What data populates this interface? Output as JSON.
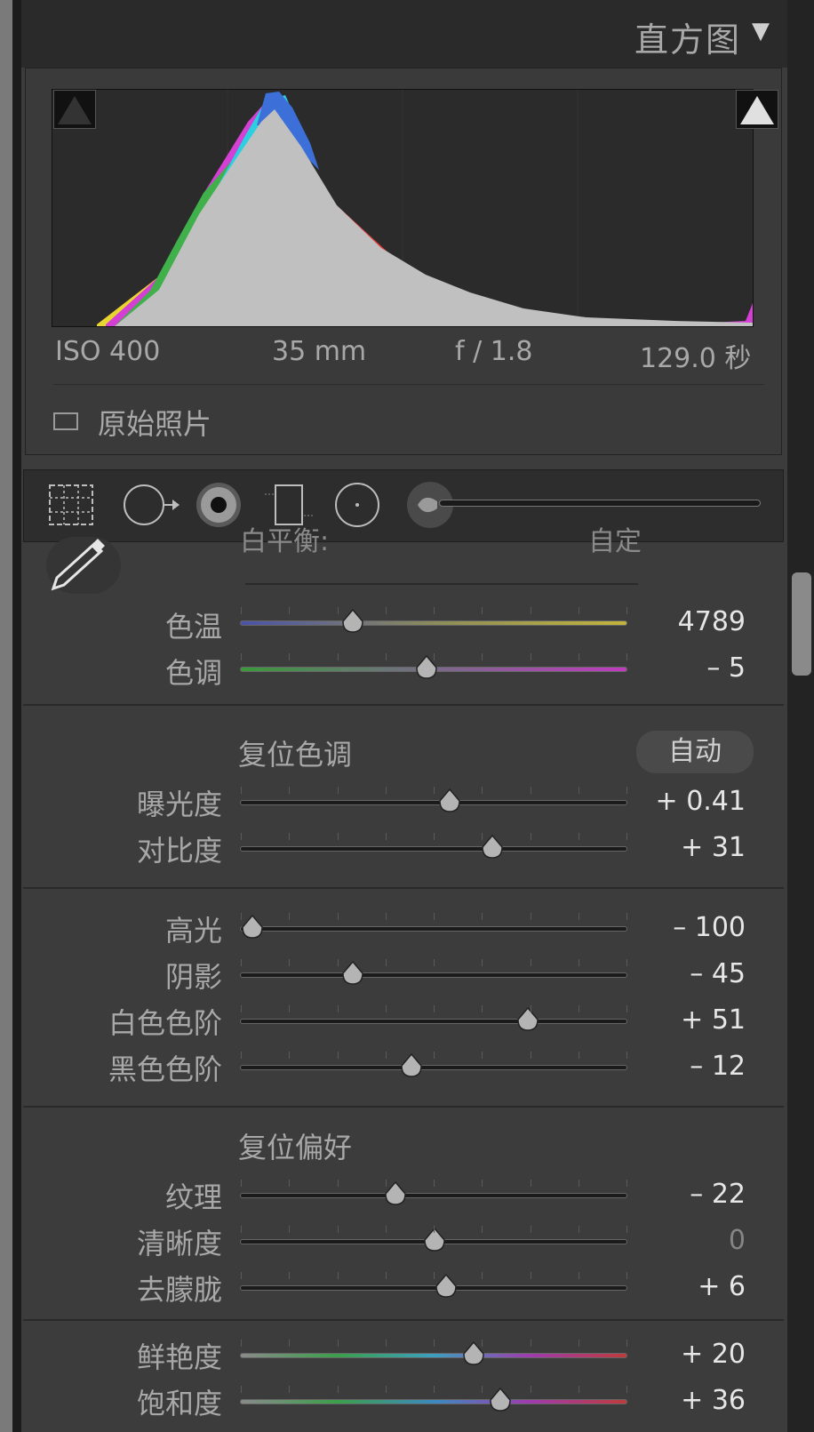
{
  "histogram": {
    "title": "直方图",
    "exif": {
      "iso": "ISO 400",
      "focal": "35 mm",
      "aperture": "f / 1.8",
      "shutter": "129.0 秒"
    },
    "original_photo_label": "原始照片"
  },
  "basic": {
    "wb_label_partial": "白平衡:",
    "wb_value_partial": "自定",
    "temp": {
      "label": "色温",
      "value": "4789",
      "pos": 0.29
    },
    "tint": {
      "label": "色调",
      "value": "– 5",
      "pos": 0.48
    },
    "tone_section": "复位色调",
    "auto_label": "自动",
    "exposure": {
      "label": "曝光度",
      "value": "+ 0.41",
      "pos": 0.54
    },
    "contrast": {
      "label": "对比度",
      "value": "+ 31",
      "pos": 0.65
    },
    "highlights": {
      "label": "高光",
      "value": "– 100",
      "pos": 0.03
    },
    "shadows": {
      "label": "阴影",
      "value": "– 45",
      "pos": 0.29
    },
    "whites": {
      "label": "白色色阶",
      "value": "+ 51",
      "pos": 0.74
    },
    "blacks": {
      "label": "黑色色阶",
      "value": "– 12",
      "pos": 0.44
    },
    "presence_section": "复位偏好",
    "texture": {
      "label": "纹理",
      "value": "– 22",
      "pos": 0.4
    },
    "clarity": {
      "label": "清晰度",
      "value": "0",
      "pos": 0.5
    },
    "dehaze": {
      "label": "去朦胧",
      "value": "+ 6",
      "pos": 0.53
    },
    "vibrance": {
      "label": "鲜艳度",
      "value": "+ 20",
      "pos": 0.6
    },
    "saturation": {
      "label": "饱和度",
      "value": "+ 36",
      "pos": 0.67
    }
  },
  "colors": {
    "panel": "#3c3c3c",
    "accent_value": "#e6e6e6"
  }
}
